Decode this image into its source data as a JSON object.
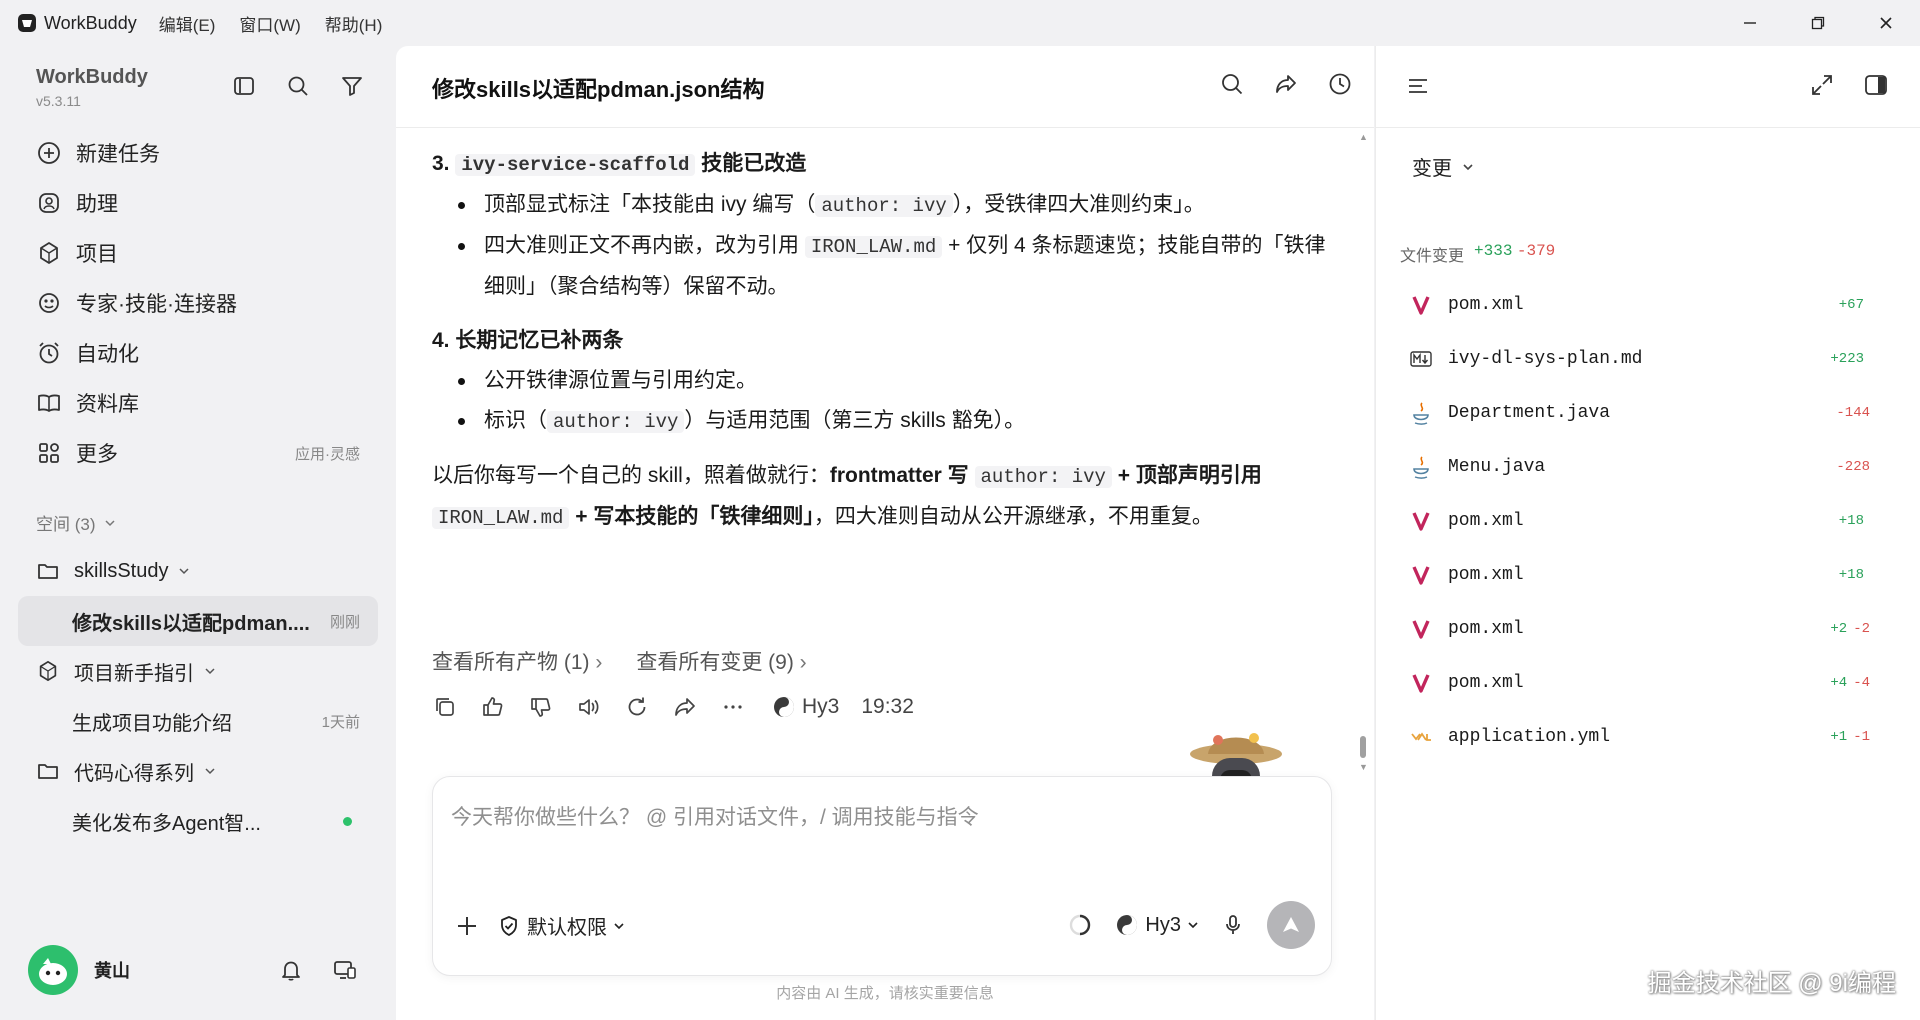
{
  "titlebar": {
    "app_name": "WorkBuddy",
    "menus": [
      "编辑(E)",
      "窗口(W)",
      "帮助(H)"
    ]
  },
  "sidebar": {
    "brand": "WorkBuddy",
    "version": "v5.3.11",
    "nav": [
      {
        "label": "新建任务",
        "icon": "plus-circle-icon"
      },
      {
        "label": "助理",
        "icon": "assistant-icon"
      },
      {
        "label": "项目",
        "icon": "project-icon"
      },
      {
        "label": "专家·技能·连接器",
        "icon": "expert-icon"
      },
      {
        "label": "自动化",
        "icon": "automation-icon"
      },
      {
        "label": "资料库",
        "icon": "library-icon"
      },
      {
        "label": "更多",
        "icon": "more-grid-icon",
        "meta": "应用·灵感"
      }
    ],
    "space_label": "空间 (3)",
    "tree": [
      {
        "label": "skillsStudy",
        "type": "folder"
      },
      {
        "label": "修改skills以适配pdman....",
        "type": "child",
        "time": "刚刚",
        "active": true
      },
      {
        "label": "项目新手指引",
        "type": "project"
      },
      {
        "label": "生成项目功能介绍",
        "type": "child",
        "time": "1天前"
      },
      {
        "label": "代码心得系列",
        "type": "folder"
      },
      {
        "label": "美化发布多Agent智...",
        "type": "child",
        "dot": true
      }
    ],
    "user_name": "黄山"
  },
  "main": {
    "title": "修改skills以适配pdman.json结构",
    "s3_num": "3.",
    "s3_code": "ivy-service-scaffold",
    "s3_title": "技能已改造",
    "b1_a": "顶部显式标注「本技能由 ivy 编写（",
    "b1_code": "author: ivy",
    "b1_b": "），受铁律四大准则约束」。",
    "b2_a": "四大准则正文不再内嵌，改为引用",
    "b2_code": "IRON_LAW.md",
    "b2_b": "+ 仅列 4 条标题速览；技能自带的「铁律细则」（聚合结构等）保留不动。",
    "s4_title": "4. 长期记忆已补两条",
    "b3": "公开铁律源位置与引用约定。",
    "b4_a": "标识（",
    "b4_code": "author: ivy",
    "b4_b": "）与适用范围（第三方 skills 豁免）。",
    "p_a": "以后你每写一个自己的 skill，照着做就行：",
    "p_b": "frontmatter 写",
    "p_code1": "author: ivy",
    "p_c": "+ 顶部声明引用",
    "p_code2": "IRON_LAW.md",
    "p_d": "+ 写本技能的「铁律细则」",
    "p_e": "，四大准则自动从公开源继承，不用重复。",
    "link_outputs": "查看所有产物 (1)",
    "link_changes": "查看所有变更 (9)",
    "model": "Hy3",
    "time": "19:32",
    "composer_placeholder": "今天帮你做些什么？ @ 引用对话文件，/ 调用技能与指令",
    "permission": "默认权限",
    "composer_model": "Hy3",
    "disclaimer": "内容由 AI 生成，请核实重要信息"
  },
  "rpanel": {
    "dropdown": "变更",
    "file_changes_label": "文件变更",
    "total_add": "+333",
    "total_del": "-379",
    "files": [
      {
        "name": "pom.xml",
        "icon": "maven-icon",
        "add": "+67",
        "del": ""
      },
      {
        "name": "ivy-dl-sys-plan.md",
        "icon": "markdown-icon",
        "add": "+223",
        "del": ""
      },
      {
        "name": "Department.java",
        "icon": "java-icon",
        "add": "",
        "del": "-144"
      },
      {
        "name": "Menu.java",
        "icon": "java-icon",
        "add": "",
        "del": "-228"
      },
      {
        "name": "pom.xml",
        "icon": "maven-icon",
        "add": "+18",
        "del": ""
      },
      {
        "name": "pom.xml",
        "icon": "maven-icon",
        "add": "+18",
        "del": ""
      },
      {
        "name": "pom.xml",
        "icon": "maven-icon",
        "add": "+2",
        "del": "-2"
      },
      {
        "name": "pom.xml",
        "icon": "maven-icon",
        "add": "+4",
        "del": "-4"
      },
      {
        "name": "application.yml",
        "icon": "yaml-icon",
        "add": "+1",
        "del": "-1"
      }
    ]
  },
  "watermark": "掘金技术社区 @ 9i编程",
  "colors": {
    "accent_green": "#2aa15a",
    "accent_red": "#d9534f",
    "status_dot": "#2dc26b"
  }
}
